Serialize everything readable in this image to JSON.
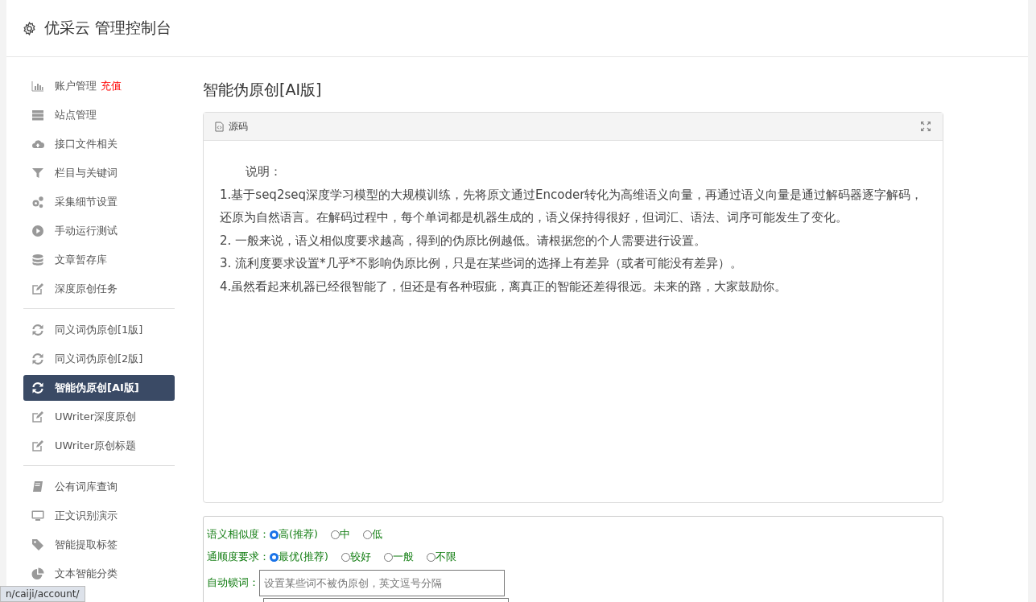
{
  "header": {
    "title": "优采云 管理控制台"
  },
  "sidebar": {
    "groups": [
      {
        "items": [
          {
            "kind": "chart",
            "label": "账户管理",
            "badge": "充值",
            "selected": false
          },
          {
            "kind": "server",
            "label": "站点管理",
            "selected": false
          },
          {
            "kind": "upload",
            "label": "接口文件相关",
            "selected": false
          },
          {
            "kind": "filter",
            "label": "栏目与关键词",
            "selected": false
          },
          {
            "kind": "gears",
            "label": "采集细节设置",
            "selected": false
          },
          {
            "kind": "play",
            "label": "手动运行测试",
            "selected": false
          },
          {
            "kind": "database",
            "label": "文章暂存库",
            "selected": false
          },
          {
            "kind": "edit",
            "label": "深度原创任务",
            "selected": false
          }
        ]
      },
      {
        "items": [
          {
            "kind": "refresh",
            "label": "同义词伪原创[1版]",
            "selected": false
          },
          {
            "kind": "refresh",
            "label": "同义词伪原创[2版]",
            "selected": false
          },
          {
            "kind": "refresh",
            "label": "智能伪原创[AI版]",
            "selected": true
          },
          {
            "kind": "edit",
            "label": "UWriter深度原创",
            "selected": false
          },
          {
            "kind": "edit",
            "label": "UWriter原创标题",
            "selected": false
          }
        ]
      },
      {
        "items": [
          {
            "kind": "book",
            "label": "公有词库查询",
            "selected": false
          },
          {
            "kind": "monitor",
            "label": "正文识别演示",
            "selected": false
          },
          {
            "kind": "tag",
            "label": "智能提取标签",
            "selected": false
          },
          {
            "kind": "pie",
            "label": "文本智能分类",
            "selected": false
          }
        ]
      }
    ]
  },
  "main": {
    "title": "智能伪原创[AI版]",
    "editor": {
      "toolbar_label": "源码",
      "paragraphs": [
        "说明：",
        "1.基于seq2seq深度学习模型的大规模训练，先将原文通过Encoder转化为高维语义向量，再通过语义向量是通过解码器逐字解码，还原为自然语言。在解码过程中，每个单词都是机器生成的，语义保持得很好，但词汇、语法、词序可能发生了变化。",
        "2. 一般来说，语义相似度要求越高，得到的伪原比例越低。请根据您的个人需要进行设置。",
        "3. 流利度要求设置*几乎*不影响伪原比例，只是在某些词的选择上有差异（或者可能没有差异）。",
        "4.虽然看起来机器已经很智能了，但还是有各种瑕疵，离真正的智能还差得很远。未来的路，大家鼓励你。"
      ]
    },
    "settings": {
      "similarity": {
        "label": "语义相似度：",
        "options": [
          {
            "label": "高(推荐)",
            "selected": true
          },
          {
            "label": "中",
            "selected": false
          },
          {
            "label": "低",
            "selected": false
          }
        ]
      },
      "fluency": {
        "label": "通顺度要求：",
        "options": [
          {
            "label": "最优(推荐)",
            "selected": true
          },
          {
            "label": "较好",
            "selected": false
          },
          {
            "label": "一般",
            "selected": false
          },
          {
            "label": "不限",
            "selected": false
          }
        ]
      },
      "lock_words": {
        "label": "自动锁词：",
        "placeholder": "设置某些词不被伪原创，英文逗号分隔"
      }
    }
  },
  "status_bar": {
    "url": "n/caiji/account/"
  }
}
